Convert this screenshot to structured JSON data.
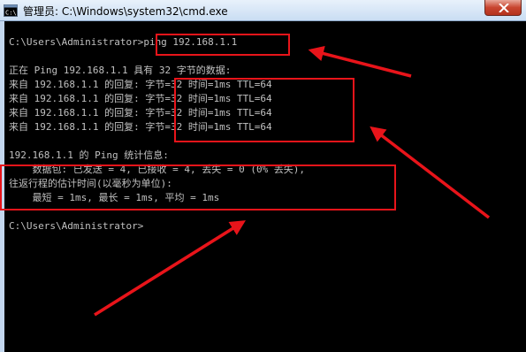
{
  "window": {
    "title": "管理员: C:\\Windows\\system32\\cmd.exe",
    "title_icon": "cmd-icon",
    "close_icon": "close-icon"
  },
  "console": {
    "prompt_line": "C:\\Users\\Administrator>ping 192.168.1.1",
    "ping_header": "正在 Ping 192.168.1.1 具有 32 字节的数据:",
    "replies": [
      "来自 192.168.1.1 的回复: 字节=32 时间=1ms TTL=64",
      "来自 192.168.1.1 的回复: 字节=32 时间=1ms TTL=64",
      "来自 192.168.1.1 的回复: 字节=32 时间=1ms TTL=64",
      "来自 192.168.1.1 的回复: 字节=32 时间=1ms TTL=64"
    ],
    "stats_header": "192.168.1.1 的 Ping 统计信息:",
    "packets_line": "    数据包: 已发送 = 4, 已接收 = 4, 丢失 = 0 (0% 丢失),",
    "rtt_header": "往返行程的估计时间(以毫秒为单位):",
    "rtt_line": "    最短 = 1ms, 最长 = 1ms, 平均 = 1ms",
    "final_prompt": "C:\\Users\\Administrator>"
  },
  "annotation_color": "#e8141a",
  "background_color": "#000000",
  "text_color": "#c0c0c0"
}
